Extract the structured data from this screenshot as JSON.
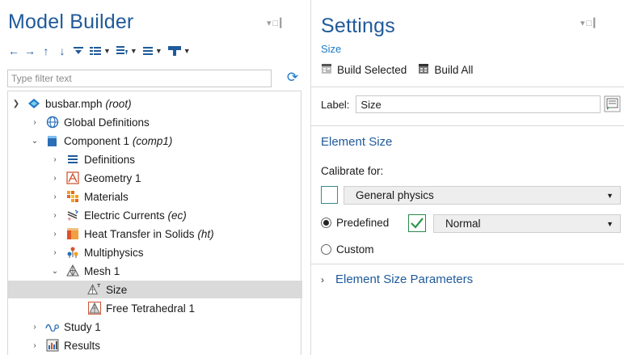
{
  "left_panel": {
    "title": "Model Builder",
    "filter": {
      "placeholder": "Type filter text",
      "value": ""
    },
    "toolbar_icons": [
      "arrow-left-icon",
      "arrow-right-icon",
      "arrow-up-icon",
      "arrow-down-icon",
      "collapse-all-icon",
      "show-icon",
      "sort-icon",
      "list-icon",
      "build-icon"
    ],
    "tree": {
      "root": {
        "label": "busbar.mph",
        "suffix": "(root)"
      },
      "global": {
        "label": "Global Definitions"
      },
      "component": {
        "label": "Component 1",
        "suffix": "(comp1)"
      },
      "definitions": {
        "label": "Definitions"
      },
      "geometry": {
        "label": "Geometry 1"
      },
      "materials": {
        "label": "Materials"
      },
      "ec": {
        "label": "Electric Currents",
        "suffix": "(ec)"
      },
      "ht": {
        "label": "Heat Transfer in Solids",
        "suffix": "(ht)"
      },
      "multiphysics": {
        "label": "Multiphysics"
      },
      "mesh": {
        "label": "Mesh 1"
      },
      "size": {
        "label": "Size"
      },
      "tet": {
        "label": "Free Tetrahedral 1"
      },
      "study": {
        "label": "Study 1"
      },
      "results": {
        "label": "Results"
      }
    }
  },
  "right_panel": {
    "title": "Settings",
    "subtitle": "Size",
    "build_selected": "Build Selected",
    "build_all": "Build All",
    "label_caption": "Label:",
    "label_value": "Size",
    "section_title": "Element Size",
    "calibrate_label": "Calibrate for:",
    "calibrate_value": "General physics",
    "predefined_label": "Predefined",
    "predefined_value": "Normal",
    "custom_label": "Custom",
    "params_title": "Element Size Parameters"
  },
  "colors": {
    "title_blue": "#1f5a9a",
    "accent_blue": "#1f7ac8",
    "selected_row": "#dadada",
    "teal_box": "#3a8a8a",
    "green_check": "#2a8a4a"
  }
}
